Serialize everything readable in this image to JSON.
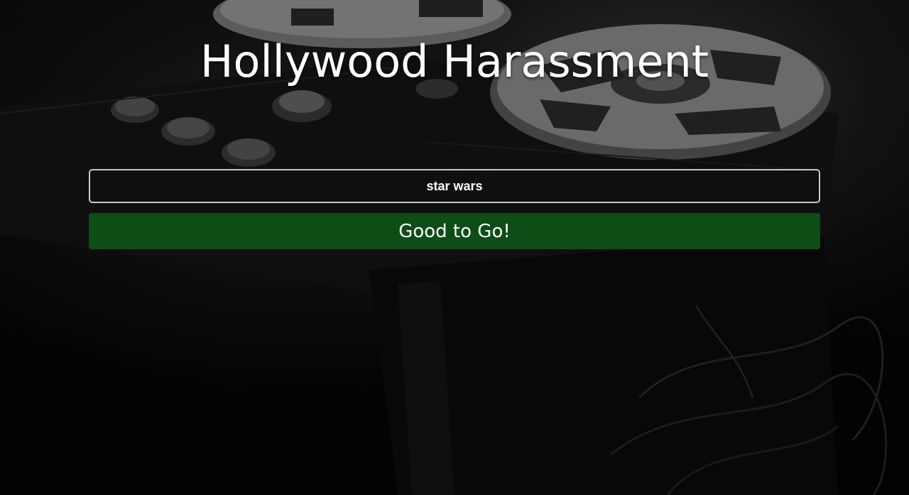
{
  "page": {
    "title": "Hollywood Harassment"
  },
  "search": {
    "value": "star wars"
  },
  "status_button": {
    "label": "Good to Go!"
  },
  "colors": {
    "button_background": "#0e4d16",
    "input_border": "#c8c8c8",
    "text": "#ffffff",
    "background": "#050505"
  }
}
